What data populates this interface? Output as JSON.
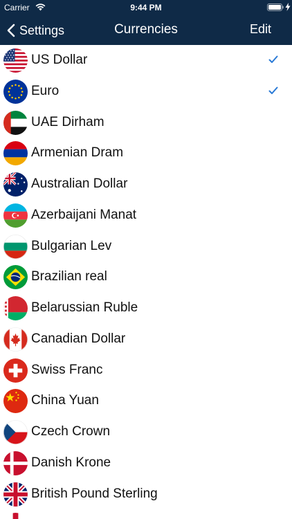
{
  "status_bar": {
    "carrier": "Carrier",
    "time": "9:44 PM"
  },
  "nav": {
    "back_label": "Settings",
    "title": "Currencies",
    "edit_label": "Edit"
  },
  "colors": {
    "nav_background": "#0f2a47",
    "checkmark": "#2a7ad6"
  },
  "currencies": [
    {
      "name": "US Dollar",
      "flag": "us-flag-icon",
      "checked": true
    },
    {
      "name": "Euro",
      "flag": "eu-flag-icon",
      "checked": true
    },
    {
      "name": "UAE Dirham",
      "flag": "uae-flag-icon",
      "checked": false
    },
    {
      "name": "Armenian Dram",
      "flag": "armenia-flag-icon",
      "checked": false
    },
    {
      "name": "Australian Dollar",
      "flag": "australia-flag-icon",
      "checked": false
    },
    {
      "name": "Azerbaijani Manat",
      "flag": "azerbaijan-flag-icon",
      "checked": false
    },
    {
      "name": "Bulgarian Lev",
      "flag": "bulgaria-flag-icon",
      "checked": false
    },
    {
      "name": "Brazilian real",
      "flag": "brazil-flag-icon",
      "checked": false
    },
    {
      "name": "Belarussian Ruble",
      "flag": "belarus-flag-icon",
      "checked": false
    },
    {
      "name": "Canadian Dollar",
      "flag": "canada-flag-icon",
      "checked": false
    },
    {
      "name": "Swiss Franc",
      "flag": "switzerland-flag-icon",
      "checked": false
    },
    {
      "name": "China Yuan",
      "flag": "china-flag-icon",
      "checked": false
    },
    {
      "name": "Czech Crown",
      "flag": "czech-flag-icon",
      "checked": false
    },
    {
      "name": "Danish Krone",
      "flag": "denmark-flag-icon",
      "checked": false
    },
    {
      "name": "British Pound Sterling",
      "flag": "uk-flag-icon",
      "checked": false
    }
  ]
}
